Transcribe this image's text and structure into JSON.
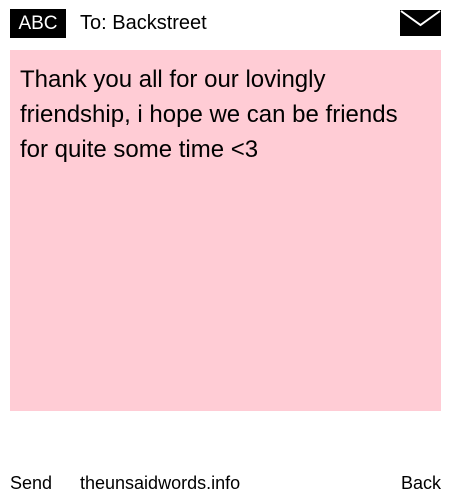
{
  "header": {
    "mode_label": "ABC",
    "recipient_label": "To: Backstreet",
    "icon": "envelope-icon"
  },
  "message": {
    "text": "Thank you all for our lovingly friendship, i hope we can be friends for quite some time <3",
    "background_color": "#ffccd5"
  },
  "footer": {
    "left_softkey": "Send",
    "site_link": "theunsaidwords.info",
    "right_softkey": "Back"
  }
}
